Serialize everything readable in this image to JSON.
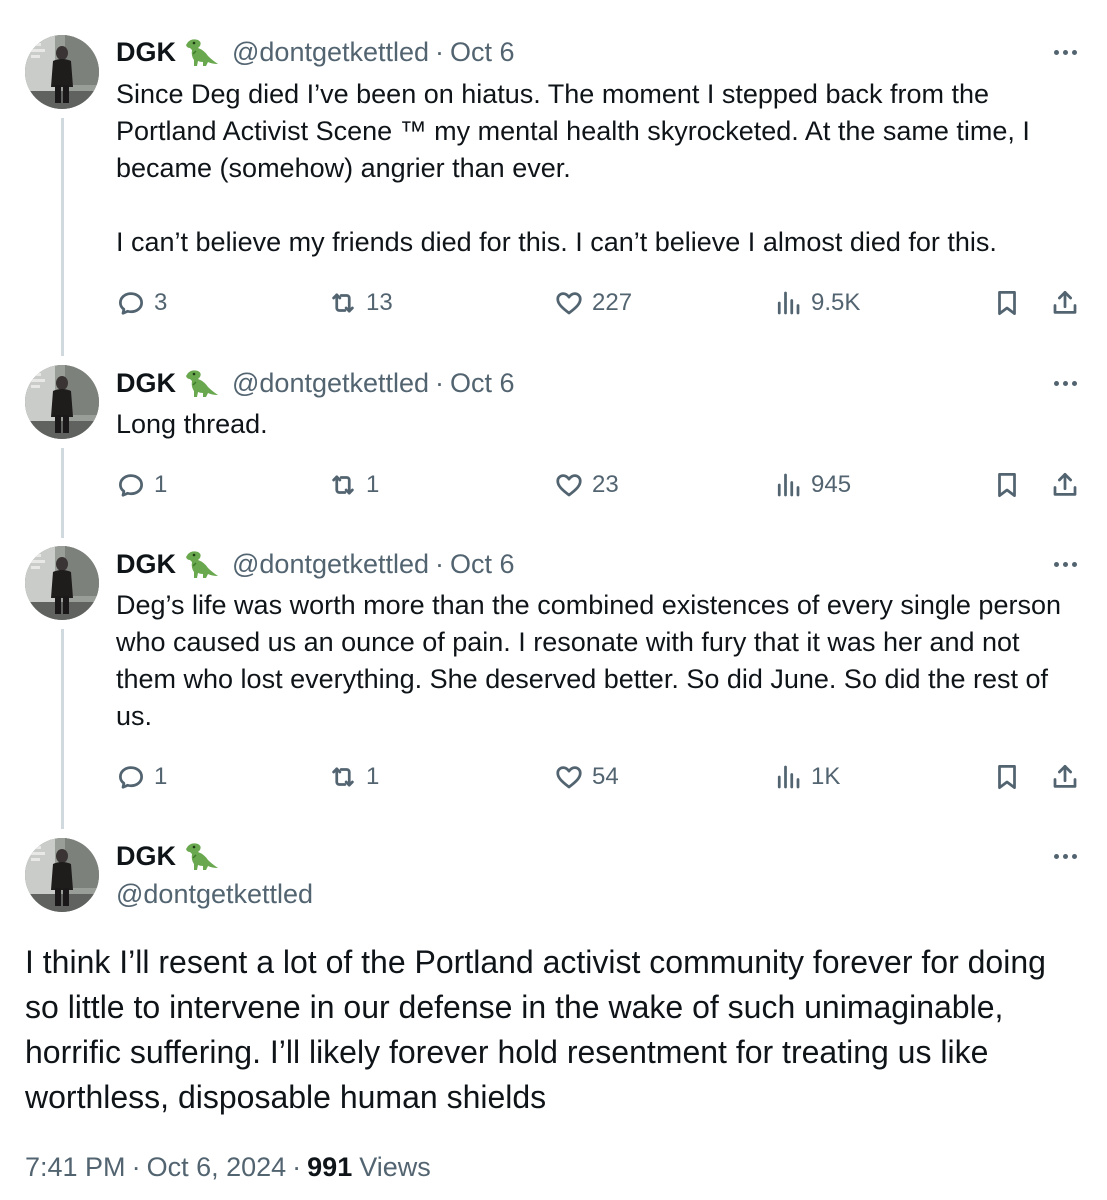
{
  "tweets": [
    {
      "name": "DGK",
      "handle": "@dontgetkettled",
      "date": "Oct 6",
      "text": "Since Deg died I’ve been on hiatus. The moment I stepped back from the Portland Activist Scene ™ my mental health skyrocketed. At the same time, I became (somehow) angrier than ever.\n\nI can’t believe my friends died for this. I can’t believe I almost died for this.",
      "replies": "3",
      "retweets": "13",
      "likes": "227",
      "views": "9.5K"
    },
    {
      "name": "DGK",
      "handle": "@dontgetkettled",
      "date": "Oct 6",
      "text": "Long thread.",
      "replies": "1",
      "retweets": "1",
      "likes": "23",
      "views": "945"
    },
    {
      "name": "DGK",
      "handle": "@dontgetkettled",
      "date": "Oct 6",
      "text": "Deg’s life was worth more than the combined existences of every single person who caused us an ounce of pain. I resonate with fury that it was her and not them who lost everything. She deserved better. So did June. So did the rest of us.",
      "replies": "1",
      "retweets": "1",
      "likes": "54",
      "views": "1K"
    }
  ],
  "main_tweet": {
    "name": "DGK",
    "handle": "@dontgetkettled",
    "text": "I think I’ll resent a lot of the Portland activist community forever for doing so little to intervene in our defense in the wake of such unimaginable, horrific suffering. I’ll likely forever hold resentment for treating us like worthless, disposable human shields",
    "time": "7:41 PM",
    "full_date": "Oct 6, 2024",
    "view_count": "991",
    "views_label": "Views"
  },
  "separator": "·",
  "icons": {
    "emoji": "t-rex-emoji-icon",
    "reply": "reply-icon",
    "retweet": "retweet-icon",
    "like": "heart-icon",
    "views": "views-bar-chart-icon",
    "bookmark": "bookmark-icon",
    "share": "share-icon",
    "more": "more-dots-icon"
  },
  "colors": {
    "text": "#0f1419",
    "secondary": "#536471",
    "thread_line": "#cfd9de",
    "dino": "#6aa84f"
  }
}
